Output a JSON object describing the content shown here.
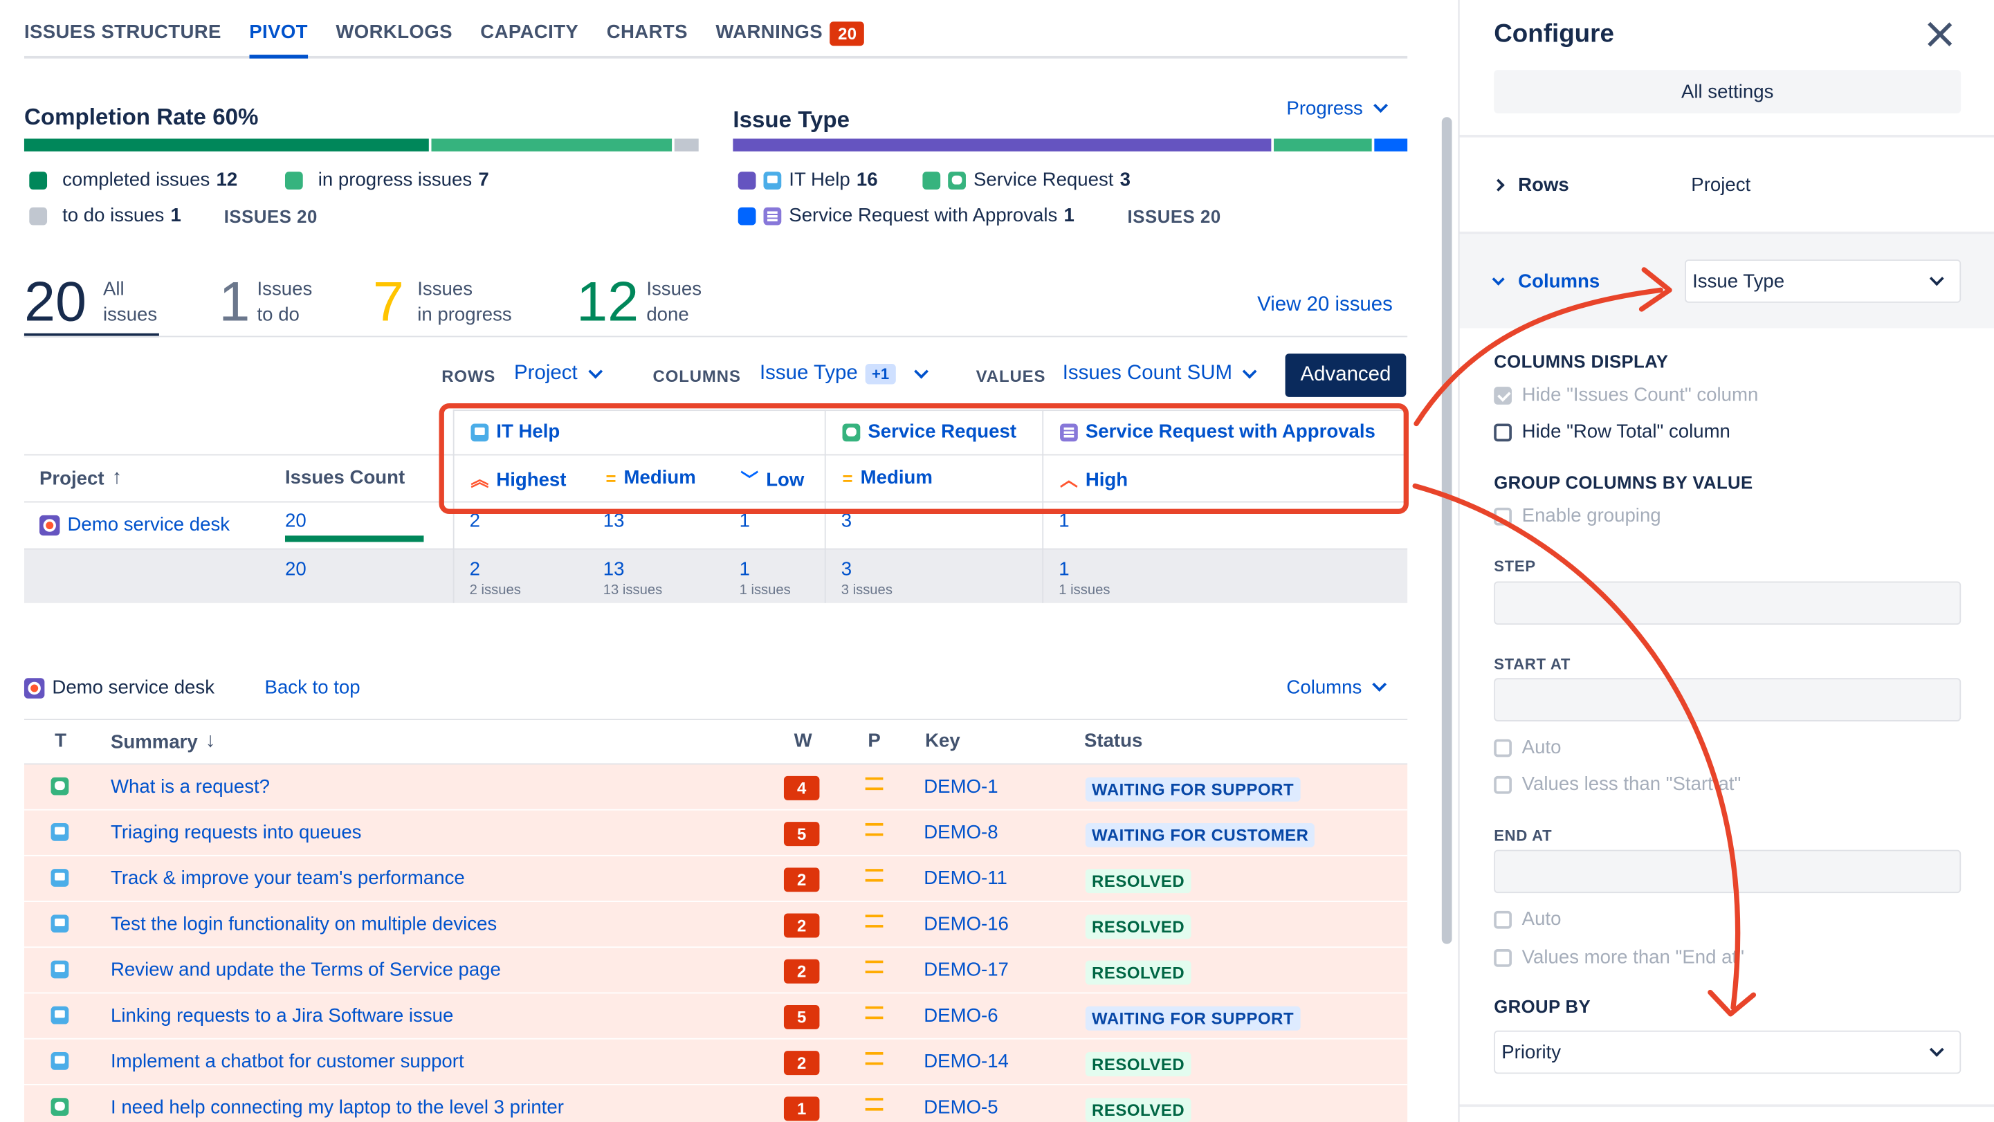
{
  "tabs": [
    {
      "label": "ISSUES STRUCTURE"
    },
    {
      "label": "PIVOT"
    },
    {
      "label": "WORKLOGS"
    },
    {
      "label": "CAPACITY"
    },
    {
      "label": "CHARTS"
    },
    {
      "label": "WARNINGS",
      "badge": "20"
    }
  ],
  "completion": {
    "title": "Completion Rate",
    "rate": "60%",
    "completed_label": "completed issues",
    "completed_count": "12",
    "in_progress_label": "in progress issues",
    "in_progress_count": "7",
    "todo_label": "to do issues",
    "todo_count": "1",
    "issues_total": "ISSUES 20",
    "fractions": {
      "completed": 0.6,
      "in_progress": 0.35,
      "todo": 0.05
    },
    "colors": {
      "completed": "#00875a",
      "in_progress": "#36b37e",
      "todo": "#c1c7d0"
    }
  },
  "issue_type": {
    "title": "Issue Type",
    "dropdown": "Progress",
    "it_help_label": "IT Help",
    "it_help_count": "16",
    "sr_label": "Service Request",
    "sr_count": "3",
    "sra_label": "Service Request with Approvals",
    "sra_count": "1",
    "issues_total": "ISSUES 20",
    "fractions": {
      "it_help": 0.8,
      "service_request": 0.15,
      "sr_approvals": 0.05
    },
    "colors": {
      "it_help": "#6554c0",
      "service_request": "#36b37e",
      "sr_approvals": "#0065ff"
    }
  },
  "stats": {
    "all_num": "20",
    "all_l1": "All",
    "all_l2": "issues",
    "todo_num": "1",
    "todo_l1": "Issues",
    "todo_l2": "to do",
    "prog_num": "7",
    "prog_l1": "Issues",
    "prog_l2": "in progress",
    "done_num": "12",
    "done_l1": "Issues",
    "done_l2": "done",
    "view_link": "View 20 issues"
  },
  "controls": {
    "rows_label": "ROWS",
    "rows_value": "Project",
    "columns_label": "COLUMNS",
    "columns_value": "Issue Type",
    "columns_extra": "+1",
    "values_label": "VALUES",
    "values_value": "Issues Count SUM",
    "advanced": "Advanced"
  },
  "pivot": {
    "col_groups": [
      "IT Help",
      "Service Request",
      "Service Request with Approvals"
    ],
    "sub_cols": [
      "Highest",
      "Medium",
      "Low",
      "Medium",
      "High"
    ],
    "project_header": "Project",
    "count_header": "Issues Count",
    "row_project": "Demo service desk",
    "row_count": "20",
    "row_values": [
      "2",
      "13",
      "1",
      "3",
      "1"
    ],
    "total_count": "20",
    "total_values": [
      "2",
      "13",
      "1",
      "3",
      "1"
    ],
    "total_subs": [
      "2 issues",
      "13 issues",
      "1 issues",
      "3 issues",
      "1 issues"
    ]
  },
  "list": {
    "project": "Demo service desk",
    "back_to_top": "Back to top",
    "columns_btn": "Columns",
    "headers": {
      "t": "T",
      "summary": "Summary",
      "w": "W",
      "p": "P",
      "key": "Key",
      "status": "Status"
    },
    "rows": [
      {
        "type": "service-request",
        "summary": "What is a request?",
        "w": "4",
        "key": "DEMO-1",
        "status": "WAITING FOR SUPPORT"
      },
      {
        "type": "it-help",
        "summary": "Triaging requests into queues",
        "w": "5",
        "key": "DEMO-8",
        "status": "WAITING FOR CUSTOMER"
      },
      {
        "type": "it-help",
        "summary": "Track & improve your team's performance",
        "w": "2",
        "key": "DEMO-11",
        "status": "RESOLVED"
      },
      {
        "type": "it-help",
        "summary": "Test the login functionality on multiple devices",
        "w": "2",
        "key": "DEMO-16",
        "status": "RESOLVED"
      },
      {
        "type": "it-help",
        "summary": "Review and update the Terms of Service page",
        "w": "2",
        "key": "DEMO-17",
        "status": "RESOLVED"
      },
      {
        "type": "it-help",
        "summary": "Linking requests to a Jira Software issue",
        "w": "5",
        "key": "DEMO-6",
        "status": "WAITING FOR SUPPORT"
      },
      {
        "type": "it-help",
        "summary": "Implement a chatbot for customer support",
        "w": "2",
        "key": "DEMO-14",
        "status": "RESOLVED"
      },
      {
        "type": "service-request",
        "summary": "I need help connecting my laptop to the level 3 printer",
        "w": "1",
        "key": "DEMO-5",
        "status": "RESOLVED"
      }
    ]
  },
  "panel": {
    "title": "Configure",
    "all_settings": "All settings",
    "rows_label": "Rows",
    "rows_value": "Project",
    "columns_label": "Columns",
    "columns_value": "Issue Type",
    "columns_display": "COLUMNS DISPLAY",
    "hide_count": "Hide \"Issues Count\" column",
    "hide_total": "Hide \"Row Total\" column",
    "group_by_value": "GROUP COLUMNS BY VALUE",
    "enable_grouping": "Enable grouping",
    "step": "STEP",
    "start_at": "START AT",
    "auto1": "Auto",
    "less_than": "Values less than \"Start at\"",
    "end_at": "END AT",
    "auto2": "Auto",
    "more_than": "Values more than \"End at\"",
    "group_by": "GROUP BY",
    "group_by_value_select": "Priority"
  }
}
